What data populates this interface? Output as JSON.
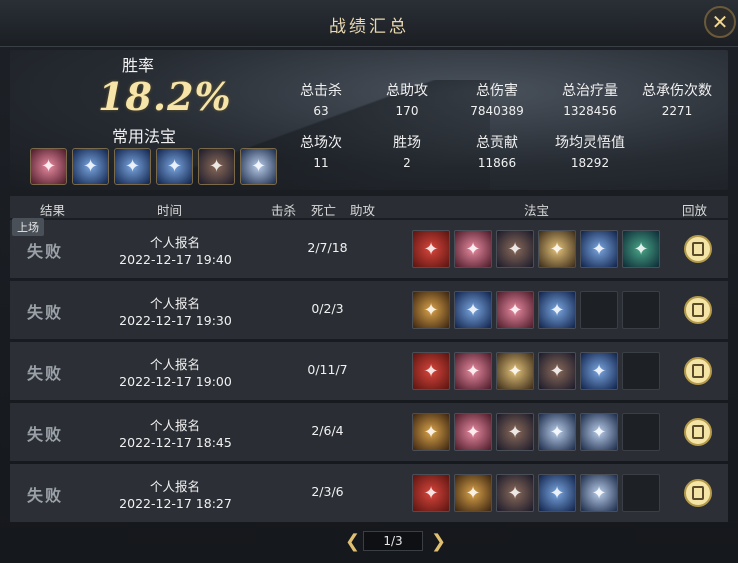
{
  "title": "战绩汇总",
  "close_icon": "close-icon",
  "summary": {
    "winrate_label": "胜率",
    "winrate": "18.2%",
    "treasure_label": "常用法宝",
    "fav_items": [
      {
        "icon": "lotus-icon",
        "theme": "c-pink"
      },
      {
        "icon": "dagger-icon",
        "theme": "c-blue"
      },
      {
        "icon": "trident-icon",
        "theme": "c-blue"
      },
      {
        "icon": "scroll-icon",
        "theme": "c-blue"
      },
      {
        "icon": "orb-icon",
        "theme": "c-orb"
      },
      {
        "icon": "axe-icon",
        "theme": "c-axe"
      }
    ],
    "stats": [
      {
        "label": "总击杀",
        "value": "63"
      },
      {
        "label": "总助攻",
        "value": "170"
      },
      {
        "label": "总伤害",
        "value": "7840389"
      },
      {
        "label": "总治疗量",
        "value": "1328456"
      },
      {
        "label": "总承伤次数",
        "value": "2271"
      },
      {
        "label": "总场次",
        "value": "11"
      },
      {
        "label": "胜场",
        "value": "2"
      },
      {
        "label": "总贡献",
        "value": "11866"
      },
      {
        "label": "场均灵悟值",
        "value": "18292"
      }
    ]
  },
  "columns": {
    "result": "结果",
    "time": "时间",
    "kills": "击杀",
    "deaths": "死亡",
    "assists": "助攻",
    "treasure": "法宝",
    "replay": "回放"
  },
  "tag": "上场",
  "rows": [
    {
      "result": "失败",
      "mode": "个人报名",
      "time": "2022-12-17 19:40",
      "kda": "2/7/18",
      "items": [
        "c-red",
        "c-pink",
        "c-orb",
        "c-book",
        "c-blue",
        "c-green"
      ]
    },
    {
      "result": "失败",
      "mode": "个人报名",
      "time": "2022-12-17 19:30",
      "kda": "0/2/3",
      "items": [
        "c-gold",
        "c-blue",
        "c-pink",
        "c-blue",
        "",
        ""
      ]
    },
    {
      "result": "失败",
      "mode": "个人报名",
      "time": "2022-12-17 19:00",
      "kda": "0/11/7",
      "items": [
        "c-red",
        "c-pink",
        "c-book",
        "c-orb",
        "c-blue",
        ""
      ]
    },
    {
      "result": "失败",
      "mode": "个人报名",
      "time": "2022-12-17 18:45",
      "kda": "2/6/4",
      "items": [
        "c-gold",
        "c-pink",
        "c-orb",
        "c-axe",
        "c-axe",
        ""
      ]
    },
    {
      "result": "失败",
      "mode": "个人报名",
      "time": "2022-12-17 18:27",
      "kda": "2/3/6",
      "items": [
        "c-red",
        "c-gold",
        "c-orb",
        "c-blue",
        "c-axe",
        ""
      ]
    }
  ],
  "pager": {
    "text": "1/3"
  }
}
